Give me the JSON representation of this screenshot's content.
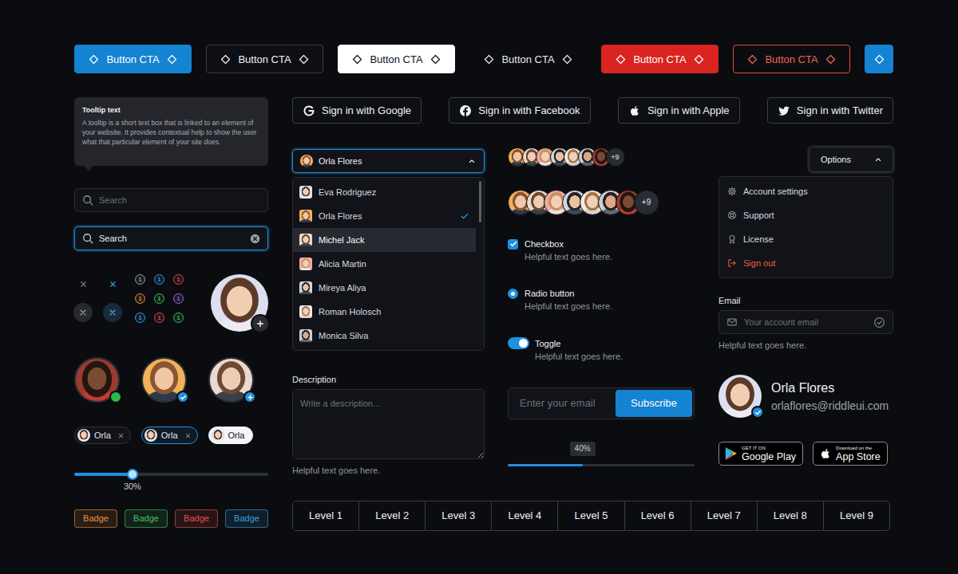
{
  "buttons": [
    {
      "label": "Button CTA",
      "kind": "primary"
    },
    {
      "label": "Button CTA",
      "kind": "dark"
    },
    {
      "label": "Button CTA",
      "kind": "light"
    },
    {
      "label": "Button CTA",
      "kind": "ghost"
    },
    {
      "label": "Button CTA",
      "kind": "danger"
    },
    {
      "label": "Button CTA",
      "kind": "danger-outline"
    },
    {
      "kind": "icon"
    }
  ],
  "tooltip": {
    "title": "Tooltip text",
    "text": "A tooltip is a short text box that is linked to an element of your website. It provides contextual help to show the user what that particular element of your site does."
  },
  "search_fields": [
    {
      "placeholder": "Search",
      "focused": false
    },
    {
      "value": "Search",
      "focused": true
    }
  ],
  "close_icons": [
    {
      "kind": "plain",
      "color": "#7d828b"
    },
    {
      "kind": "plain",
      "color": "#3b9fe0"
    },
    {
      "kind": "round",
      "color": "#9aa0a8"
    },
    {
      "kind": "round",
      "color": "#4aa8e6"
    }
  ],
  "count_dots": [
    {
      "text": "1",
      "color": "#9aa0a8"
    },
    {
      "text": "1",
      "color": "#3b9fe0"
    },
    {
      "text": "1",
      "color": "#e5484d"
    },
    {
      "text": "1",
      "color": "#e8913a"
    },
    {
      "text": "1",
      "color": "#3fbf5a"
    },
    {
      "text": "1",
      "color": "#9b6cf0"
    },
    {
      "text": "1",
      "color": "#3b9fe0"
    },
    {
      "text": "1",
      "color": "#e5484d"
    },
    {
      "text": "1",
      "color": "#3fbf5a"
    }
  ],
  "featured_avatar": {
    "add_button": true
  },
  "status_avatars": [
    {
      "kind": "online"
    },
    {
      "kind": "verified"
    },
    {
      "kind": "add"
    }
  ],
  "chips": [
    {
      "label": "Orla",
      "kind": "default",
      "removable": true
    },
    {
      "label": "Orla",
      "kind": "focused",
      "removable": true
    },
    {
      "label": "Orla",
      "kind": "light",
      "removable": false
    }
  ],
  "slider": {
    "level": 0.3,
    "reading": "30%"
  },
  "badges": [
    {
      "label": "Badge",
      "color": "#e8913a"
    },
    {
      "label": "Badge",
      "color": "#46c060"
    },
    {
      "label": "Badge",
      "color": "#e5534b"
    },
    {
      "label": "Badge",
      "color": "#3b9fe0"
    }
  ],
  "social_buttons": [
    {
      "label": "Sign in with Google",
      "kind": "google"
    },
    {
      "label": "Sign in with Facebook",
      "kind": "facebook"
    },
    {
      "label": "Sign in with Apple",
      "kind": "apple"
    },
    {
      "label": "Sign in with Twitter",
      "kind": "twitter"
    }
  ],
  "person_select": {
    "value": "Orla Flores",
    "expanded": true,
    "options": [
      {
        "name": "Eva Rodriguez",
        "selected": false,
        "highlighted": false
      },
      {
        "name": "Orla Flores",
        "selected": true,
        "highlighted": false
      },
      {
        "name": "Michel Jack",
        "selected": false,
        "highlighted": true
      },
      {
        "name": "Alicia Martin",
        "selected": false,
        "highlighted": false
      },
      {
        "name": "Mireya Aliya",
        "selected": false,
        "highlighted": false
      },
      {
        "name": "Roman Holosch",
        "selected": false,
        "highlighted": false
      },
      {
        "name": "Monica Silva",
        "selected": false,
        "highlighted": false
      }
    ]
  },
  "description": {
    "label": "Description",
    "placeholder": "Write a description...",
    "helper": "Helpful text goes here."
  },
  "avatar_groups": [
    {
      "kind": "small",
      "avatars": 7,
      "more": "+9"
    },
    {
      "kind": "large",
      "avatars": 7,
      "more": "+9"
    }
  ],
  "choices": [
    {
      "kind": "checkbox",
      "label": "Checkbox",
      "helper": "Helpful text goes here.",
      "checked": true
    },
    {
      "kind": "radio",
      "label": "Radio button",
      "helper": "Helpful text goes here.",
      "checked": true
    },
    {
      "kind": "toggle",
      "label": "Toggle",
      "helper": "Helpful text goes here.",
      "checked": true
    }
  ],
  "subscribe": {
    "placeholder": "Enter your email",
    "button": "Subscribe"
  },
  "progress": {
    "level": 0.4,
    "reading": "40%"
  },
  "options_menu": {
    "label": "Options",
    "expanded": true,
    "items": [
      {
        "label": "Account settings",
        "kind": "settings"
      },
      {
        "label": "Support",
        "kind": "support"
      },
      {
        "label": "License",
        "kind": "license"
      },
      {
        "label": "Sign out",
        "kind": "sign-out"
      }
    ]
  },
  "email_field": {
    "label": "Email",
    "placeholder": "Your account email",
    "helper": "Helpful text goes here.",
    "valid": true
  },
  "profile": {
    "name": "Orla Flores",
    "email": "orlaflores@riddleui.com",
    "verified": true
  },
  "store_badges": [
    {
      "kind": "google-play",
      "caption": "GET IT ON",
      "label": "Google Play"
    },
    {
      "kind": "app-store",
      "caption": "Download on the",
      "label": "App Store"
    }
  ],
  "levels": [
    "Level 1",
    "Level 2",
    "Level 3",
    "Level 4",
    "Level 5",
    "Level 6",
    "Level 7",
    "Level 8",
    "Level 9"
  ]
}
